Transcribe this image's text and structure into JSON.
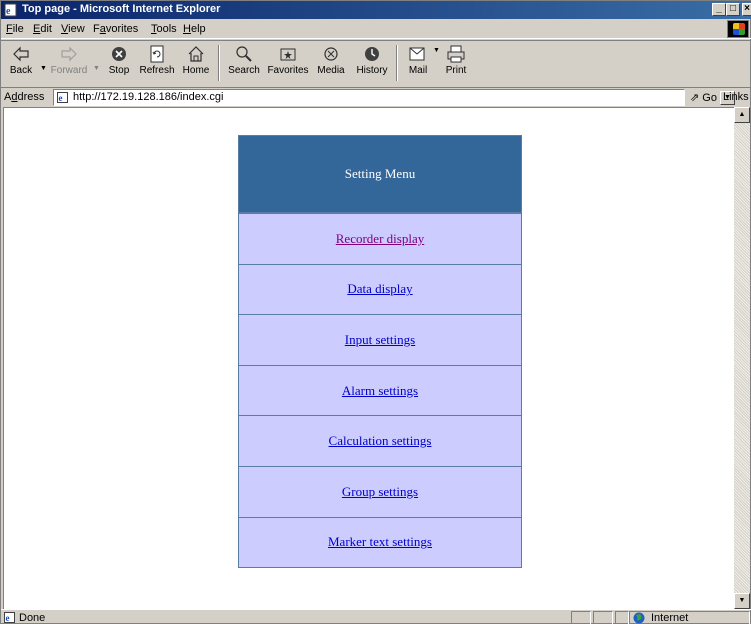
{
  "window": {
    "title": "Top page - Microsoft Internet Explorer",
    "min_label": "_",
    "max_label": "□",
    "close_label": "×"
  },
  "menubar": {
    "items": [
      {
        "u": "F",
        "rest": "ile"
      },
      {
        "u": "E",
        "rest": "dit"
      },
      {
        "u": "V",
        "rest": "iew"
      },
      {
        "u": "",
        "pre": "F",
        "u2": "a",
        "rest": "vorites"
      },
      {
        "u": "T",
        "rest": "ools"
      },
      {
        "u": "H",
        "rest": "elp"
      }
    ]
  },
  "toolbar": {
    "back": "Back",
    "forward": "Forward",
    "stop": "Stop",
    "refresh": "Refresh",
    "home": "Home",
    "search": "Search",
    "favorites": "Favorites",
    "media": "Media",
    "history": "History",
    "mail": "Mail",
    "print": "Print"
  },
  "address": {
    "label_pre": "A",
    "label_u": "d",
    "label_rest": "dress",
    "url": "http://172.19.128.186/index.cgi",
    "go": "Go",
    "links": "Links »"
  },
  "page": {
    "header": "Setting Menu",
    "items": [
      {
        "label": "Recorder display",
        "visited": true
      },
      {
        "label": "Data display",
        "visited": false
      },
      {
        "label": "Input settings",
        "visited": false
      },
      {
        "label": "Alarm settings",
        "visited": false
      },
      {
        "label": "Calculation settings",
        "visited": false
      },
      {
        "label": "Group settings",
        "visited": false
      },
      {
        "label": "Marker text settings",
        "visited": false
      }
    ],
    "header_color": "#336699",
    "row_color": "#ccccff",
    "link_color": "#0000cc",
    "visited_color": "#800080"
  },
  "status": {
    "text": "Done",
    "zone": "Internet"
  }
}
